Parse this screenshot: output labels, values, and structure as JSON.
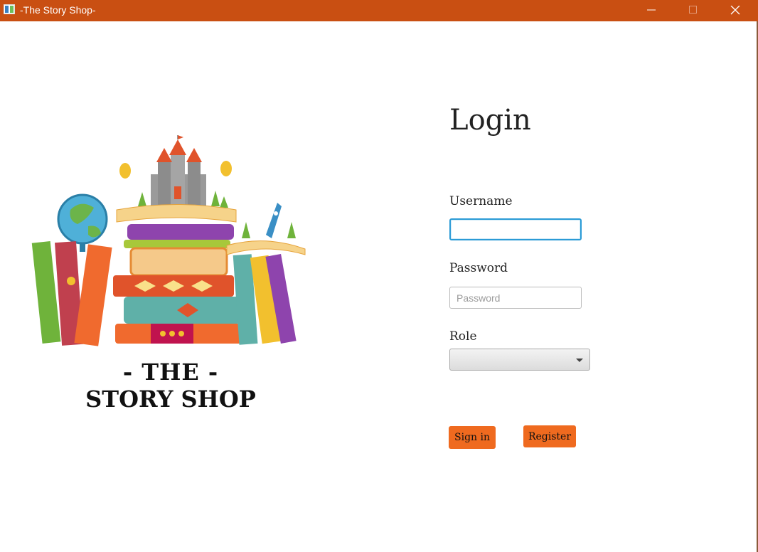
{
  "window": {
    "title": "-The Story Shop-",
    "titlebar_color": "#c94f12",
    "controls": [
      "minimize-icon",
      "maximize-icon",
      "close-icon"
    ]
  },
  "brand": {
    "line1": "- THE -",
    "line2": "STORY SHOP"
  },
  "form": {
    "title": "Login",
    "username_label": "Username",
    "username_value": "",
    "password_label": "Password",
    "password_placeholder": "Password",
    "role_label": "Role",
    "role_value": "",
    "signin_label": "Sign in",
    "register_label": "Register",
    "accent": "#ef6a1f",
    "focus_color": "#2b9bd6"
  }
}
